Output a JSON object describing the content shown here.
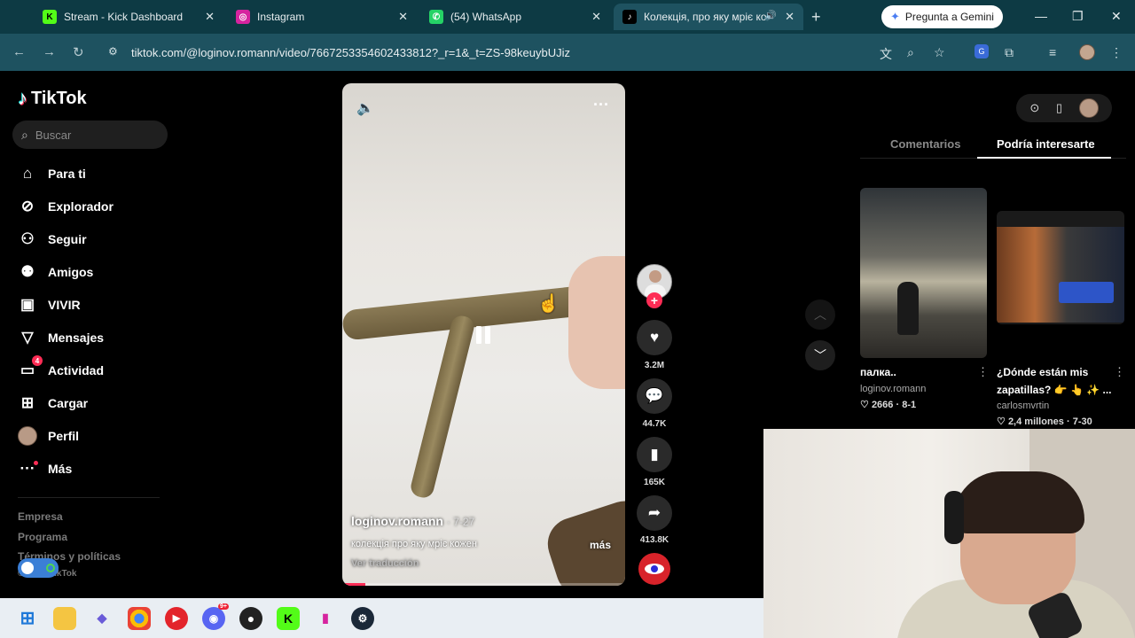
{
  "browser": {
    "tabs": [
      {
        "title": "Stream - Kick Dashboard",
        "icon": "kick-icon",
        "fav": "K",
        "fav_color": "#53fc18",
        "fav_text": "#000"
      },
      {
        "title": "Instagram",
        "icon": "instagram-icon",
        "fav": "◎",
        "fav_color": "#d6249f",
        "fav_text": "#fff"
      },
      {
        "title": "(54) WhatsApp",
        "icon": "whatsapp-icon",
        "fav": "✆",
        "fav_color": "#25d366",
        "fav_text": "#fff"
      },
      {
        "title": "Колекція, про яку мріє ко",
        "icon": "tiktok-icon",
        "fav": "♪",
        "fav_color": "#000",
        "fav_text": "#fff"
      }
    ],
    "gemini_label": "Pregunta a Gemini",
    "url": "tiktok.com/@loginov.romann/video/7667253354602433812?_r=1&_t=ZS-98keuybUJiz"
  },
  "tiktok": {
    "brand": "TikTok",
    "search_placeholder": "Buscar",
    "nav": [
      {
        "label": "Para ti",
        "icon": "home-icon"
      },
      {
        "label": "Explorador",
        "icon": "compass-icon"
      },
      {
        "label": "Seguir",
        "icon": "follow-icon"
      },
      {
        "label": "Amigos",
        "icon": "friends-icon"
      },
      {
        "label": "VIVIR",
        "icon": "live-icon"
      },
      {
        "label": "Mensajes",
        "icon": "messages-icon"
      },
      {
        "label": "Actividad",
        "icon": "activity-icon",
        "badge": "4"
      },
      {
        "label": "Cargar",
        "icon": "upload-icon"
      },
      {
        "label": "Perfil",
        "icon": "profile-avatar"
      },
      {
        "label": "Más",
        "icon": "more-icon"
      }
    ],
    "footer": [
      "Empresa",
      "Programa",
      "Términos y políticas",
      "© 2025 TikTok"
    ]
  },
  "video": {
    "username": "loginov.romann",
    "date": "7-27",
    "caption": "колекція про яку мріє кожен",
    "more": "más",
    "translate": "Ver traducción",
    "progress": 0.08
  },
  "actions": {
    "likes": "3.2M",
    "comments": "44.7K",
    "saves": "165K",
    "shares": "413.8K"
  },
  "right_panel": {
    "tabs": [
      "Comentarios",
      "Podría interesarte"
    ],
    "active_tab": 1,
    "suggestions": [
      {
        "title": "палка..",
        "user": "loginov.romann",
        "likes": "2666",
        "date": "8-1"
      },
      {
        "title": "¿Dónde están mis zapatillas? 👉 👆 ✨ ...",
        "user": "carlosmvrtin",
        "likes": "2,4 millones",
        "date": "7-30"
      }
    ]
  },
  "colors": {
    "accent": "#fe2c55",
    "chrome": "#1e5260"
  }
}
